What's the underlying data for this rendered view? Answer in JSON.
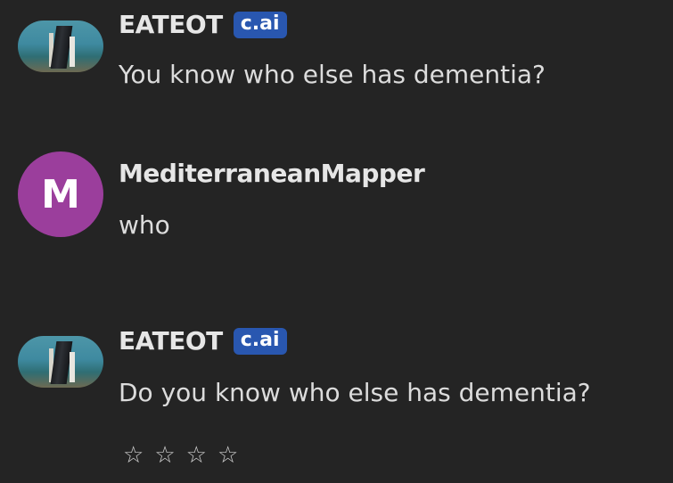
{
  "messages": [
    {
      "author": "EATEOT",
      "badge": "c.ai",
      "text": "You know who else has dementia?",
      "avatar_type": "image"
    },
    {
      "author": "MediterraneanMapper",
      "avatar_letter": "M",
      "avatar_color": "#9b3e9c",
      "text": "who",
      "avatar_type": "letter"
    },
    {
      "author": "EATEOT",
      "badge": "c.ai",
      "text": "Do you know who else has dementia?",
      "avatar_type": "image"
    }
  ],
  "rating": {
    "stars": [
      "☆",
      "☆",
      "☆",
      "☆"
    ],
    "icon": "star-outline-icon"
  },
  "colors": {
    "background": "#242424",
    "badge": "#2957b0",
    "username": "#e6e6e6",
    "text": "#dcdcdc"
  }
}
